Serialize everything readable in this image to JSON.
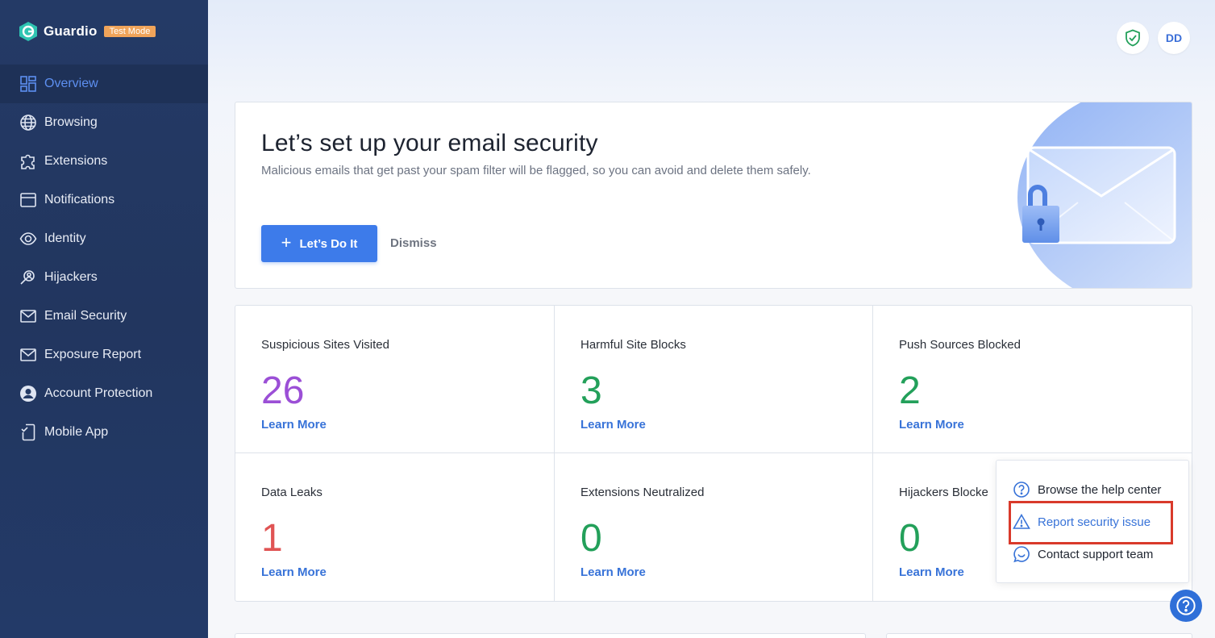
{
  "brand": {
    "name": "Guardio",
    "mode_badge": "Test Mode"
  },
  "sidebar": {
    "items": [
      {
        "label": "Overview",
        "icon": "dashboard-icon",
        "active": true
      },
      {
        "label": "Browsing",
        "icon": "globe-icon"
      },
      {
        "label": "Extensions",
        "icon": "puzzle-icon"
      },
      {
        "label": "Notifications",
        "icon": "notification-window-icon"
      },
      {
        "label": "Identity",
        "icon": "eye-icon"
      },
      {
        "label": "Hijackers",
        "icon": "search-person-icon"
      },
      {
        "label": "Email Security",
        "icon": "mail-icon"
      },
      {
        "label": "Exposure Report",
        "icon": "mail-icon"
      },
      {
        "label": "Account Protection",
        "icon": "user-circle-icon"
      },
      {
        "label": "Mobile App",
        "icon": "mobile-check-icon"
      }
    ]
  },
  "header": {
    "avatar_initials": "DD",
    "shield_icon": "shield-check-icon"
  },
  "setup": {
    "title": "Let’s set up your email security",
    "subtitle": "Malicious emails that get past your spam filter will be flagged, so you can avoid and delete them safely.",
    "cta_label": "Let’s Do It",
    "dismiss_label": "Dismiss"
  },
  "stats": [
    {
      "label": "Suspicious Sites Visited",
      "value": "26",
      "color": "#9b4fd6",
      "link": "Learn More"
    },
    {
      "label": "Harmful Site Blocks",
      "value": "3",
      "color": "#23a05a",
      "link": "Learn More"
    },
    {
      "label": "Push Sources Blocked",
      "value": "2",
      "color": "#23a05a",
      "link": "Learn More"
    },
    {
      "label": "Data Leaks",
      "value": "1",
      "color": "#e05454",
      "link": "Learn More"
    },
    {
      "label": "Extensions Neutralized",
      "value": "0",
      "color": "#23a05a",
      "link": "Learn More"
    },
    {
      "label": "Hijackers Blocke",
      "value": "0",
      "color": "#23a05a",
      "link": "Learn More"
    }
  ],
  "help_menu": {
    "items": [
      {
        "label": "Browse the help center",
        "icon": "question-circle-icon"
      },
      {
        "label": "Report security issue",
        "icon": "warning-triangle-icon"
      },
      {
        "label": "Contact support team",
        "icon": "chat-bubble-icon"
      }
    ]
  },
  "colors": {
    "accent": "#3d7bea",
    "sidebar": "#243a66",
    "highlight_border": "#d93a2b"
  }
}
